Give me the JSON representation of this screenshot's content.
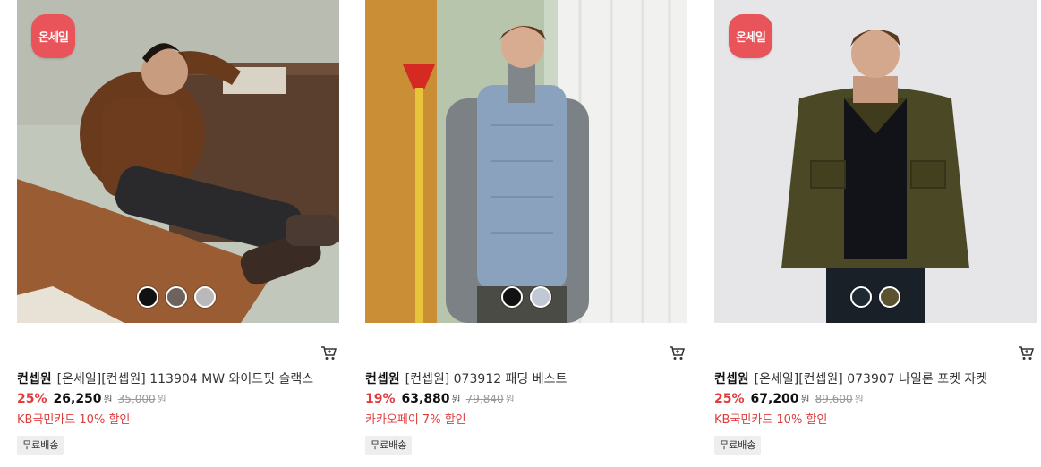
{
  "products": [
    {
      "badge": "온세일",
      "brand": "컨셉원",
      "name": "[온세일][컨셉원] 113904 MW 와이드핏 슬랙스",
      "discount_rate": "25%",
      "sale_price": "26,250",
      "currency": "원",
      "original_price": "35,000",
      "promo": "KB국민카드 10% 할인",
      "shipping": "무료배송",
      "colors": [
        "#111111",
        "#6e625d",
        "#b9b9b9"
      ],
      "cart_icon": "cart-icon"
    },
    {
      "badge": "",
      "brand": "컨셉원",
      "name": "[컨셉원] 073912 패딩 베스트",
      "discount_rate": "19%",
      "sale_price": "63,880",
      "currency": "원",
      "original_price": "79,840",
      "promo": "카카오페이 7% 할인",
      "shipping": "무료배송",
      "colors": [
        "#111111",
        "#bfc8d4"
      ],
      "cart_icon": "cart-icon"
    },
    {
      "badge": "온세일",
      "brand": "컨셉원",
      "name": "[온세일][컨셉원] 073907 나일론 포켓 자켓",
      "discount_rate": "25%",
      "sale_price": "67,200",
      "currency": "원",
      "original_price": "89,600",
      "promo": "KB국민카드 10% 할인",
      "shipping": "무료배송",
      "colors": [
        "#1d2a33",
        "#5b5230"
      ],
      "cart_icon": "cart-icon"
    }
  ],
  "colors": {
    "badge_bg": "#e9535a",
    "discount": "#e03c3c",
    "ship_tag_bg": "#eeeeee"
  }
}
